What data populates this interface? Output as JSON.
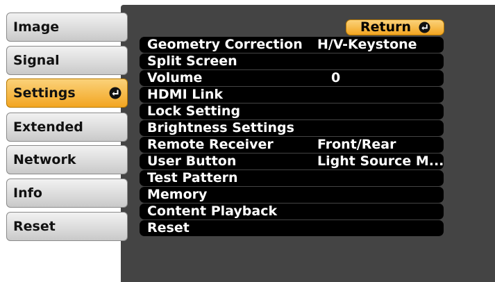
{
  "sidebar": {
    "items": [
      {
        "label": "Image"
      },
      {
        "label": "Signal"
      },
      {
        "label": "Settings",
        "selected": true
      },
      {
        "label": "Extended"
      },
      {
        "label": "Network"
      },
      {
        "label": "Info"
      },
      {
        "label": "Reset"
      }
    ]
  },
  "return_button": {
    "label": "Return"
  },
  "menu": {
    "rows": [
      {
        "label": "Geometry Correction",
        "value": "H/V-Keystone"
      },
      {
        "label": "Split Screen",
        "value": ""
      },
      {
        "label": "Volume",
        "value": "0"
      },
      {
        "label": "HDMI Link",
        "value": ""
      },
      {
        "label": "Lock Setting",
        "value": ""
      },
      {
        "label": "Brightness Settings",
        "value": ""
      },
      {
        "label": "Remote Receiver",
        "value": "Front/Rear"
      },
      {
        "label": "User Button",
        "value": "Light Source M..."
      },
      {
        "label": "Test Pattern",
        "value": ""
      },
      {
        "label": "Memory",
        "value": ""
      },
      {
        "label": "Content Playback",
        "value": ""
      },
      {
        "label": "Reset",
        "value": ""
      }
    ]
  },
  "colors": {
    "panel": "#444444",
    "highlight": "#f2a521",
    "row": "#000000"
  }
}
